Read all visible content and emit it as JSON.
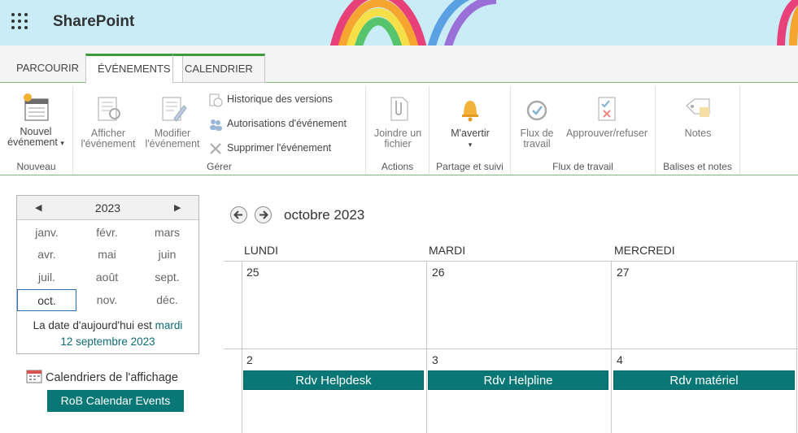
{
  "header": {
    "brand": "SharePoint"
  },
  "tabs": [
    {
      "label": "PARCOURIR"
    },
    {
      "label": "ÉVÉNEMENTS"
    },
    {
      "label": "CALENDRIER"
    }
  ],
  "ribbon": {
    "nouveau": {
      "new_event_line1": "Nouvel",
      "new_event_line2": "événement",
      "group": "Nouveau"
    },
    "gerer": {
      "view_line1": "Afficher",
      "view_line2": "l'événement",
      "edit_line1": "Modifier",
      "edit_line2": "l'événement",
      "history": "Historique des versions",
      "permissions": "Autorisations d'événement",
      "delete": "Supprimer l'événement",
      "group": "Gérer"
    },
    "actions": {
      "attach_line1": "Joindre un",
      "attach_line2": "fichier",
      "group": "Actions"
    },
    "partage": {
      "alert": "M'avertir",
      "group": "Partage et suivi"
    },
    "flux": {
      "workflow_line1": "Flux de",
      "workflow_line2": "travail",
      "approve": "Approuver/refuser",
      "group": "Flux de travail"
    },
    "balises": {
      "notes": "Notes",
      "group": "Balises et notes"
    }
  },
  "datepicker": {
    "year": "2023",
    "months": [
      "janv.",
      "févr.",
      "mars",
      "avr.",
      "mai",
      "juin",
      "juil.",
      "août",
      "sept.",
      "oct.",
      "nov.",
      "déc."
    ],
    "selected": "oct.",
    "today_prefix": "La date d'aujourd'hui est",
    "today_day": "mardi",
    "today_date": "12 septembre 2023"
  },
  "calendar_views": {
    "label": "Calendriers de l'affichage",
    "overlay": "RoB Calendar Events"
  },
  "calendar": {
    "month_title": "octobre 2023",
    "day_headers": [
      "LUNDI",
      "MARDI",
      "MERCREDI"
    ],
    "week1": [
      "25",
      "26",
      "27"
    ],
    "week2": [
      "2",
      "3",
      "4"
    ],
    "events": [
      "Rdv Helpdesk",
      "Rdv Helpline",
      "Rdv matériel"
    ]
  },
  "colors": {
    "accent_green": "#3c9a3c",
    "event_teal": "#0a7777",
    "link_teal": "#0d6b76"
  }
}
